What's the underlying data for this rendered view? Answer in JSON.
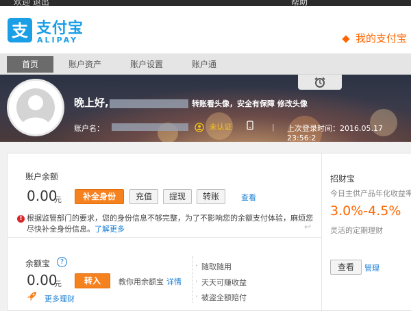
{
  "topbar": {
    "left_text": "欢迎 退出",
    "right_text": "帮助"
  },
  "header": {
    "logo_cn": "支付宝",
    "logo_en": "ALIPAY",
    "my_alipay": "我的支付宝"
  },
  "nav": {
    "tabs": [
      "首页",
      "账户资产",
      "账户设置",
      "账户通"
    ]
  },
  "profile": {
    "greeting": "晚上好,",
    "avatar_tip": "转账看头像，安全有保障",
    "edit_avatar": "修改头像",
    "account_label": "账户名：",
    "verify_status": "未认证",
    "last_login": "上次登录时间：2016.05.17 23:56:2"
  },
  "balance": {
    "title": "账户余额",
    "amount": "0.00",
    "unit": "元",
    "buttons": [
      "补全身份",
      "充值",
      "提现",
      "转账"
    ],
    "view_link": "查看",
    "notice": "根据监管部门的要求，您的身份信息不够完整，为了不影响您的余额支付体验，麻烦您尽快补全身份信息。",
    "learn_more": "了解更多"
  },
  "yuebao": {
    "title": "余额宝",
    "help": "?",
    "amount": "0.00",
    "unit": "元",
    "transfer_in": "转入",
    "guide": "教你用余额宝",
    "detail_link": "详情",
    "features": [
      "随取随用",
      "天天可赚收益",
      "被盗全额赔付"
    ],
    "more_link": "更多理财"
  },
  "zhaocaibao": {
    "title": "招财宝",
    "subtitle": "今日主供产品年化收益率",
    "rate": "3.0%-4.5%",
    "desc": "灵活的定期理财",
    "view_button": "查看",
    "manage_link": "管理"
  },
  "colors": {
    "brand_blue": "#1a9ee6",
    "accent_orange": "#f5811f",
    "link_blue": "#1a7fd4"
  }
}
